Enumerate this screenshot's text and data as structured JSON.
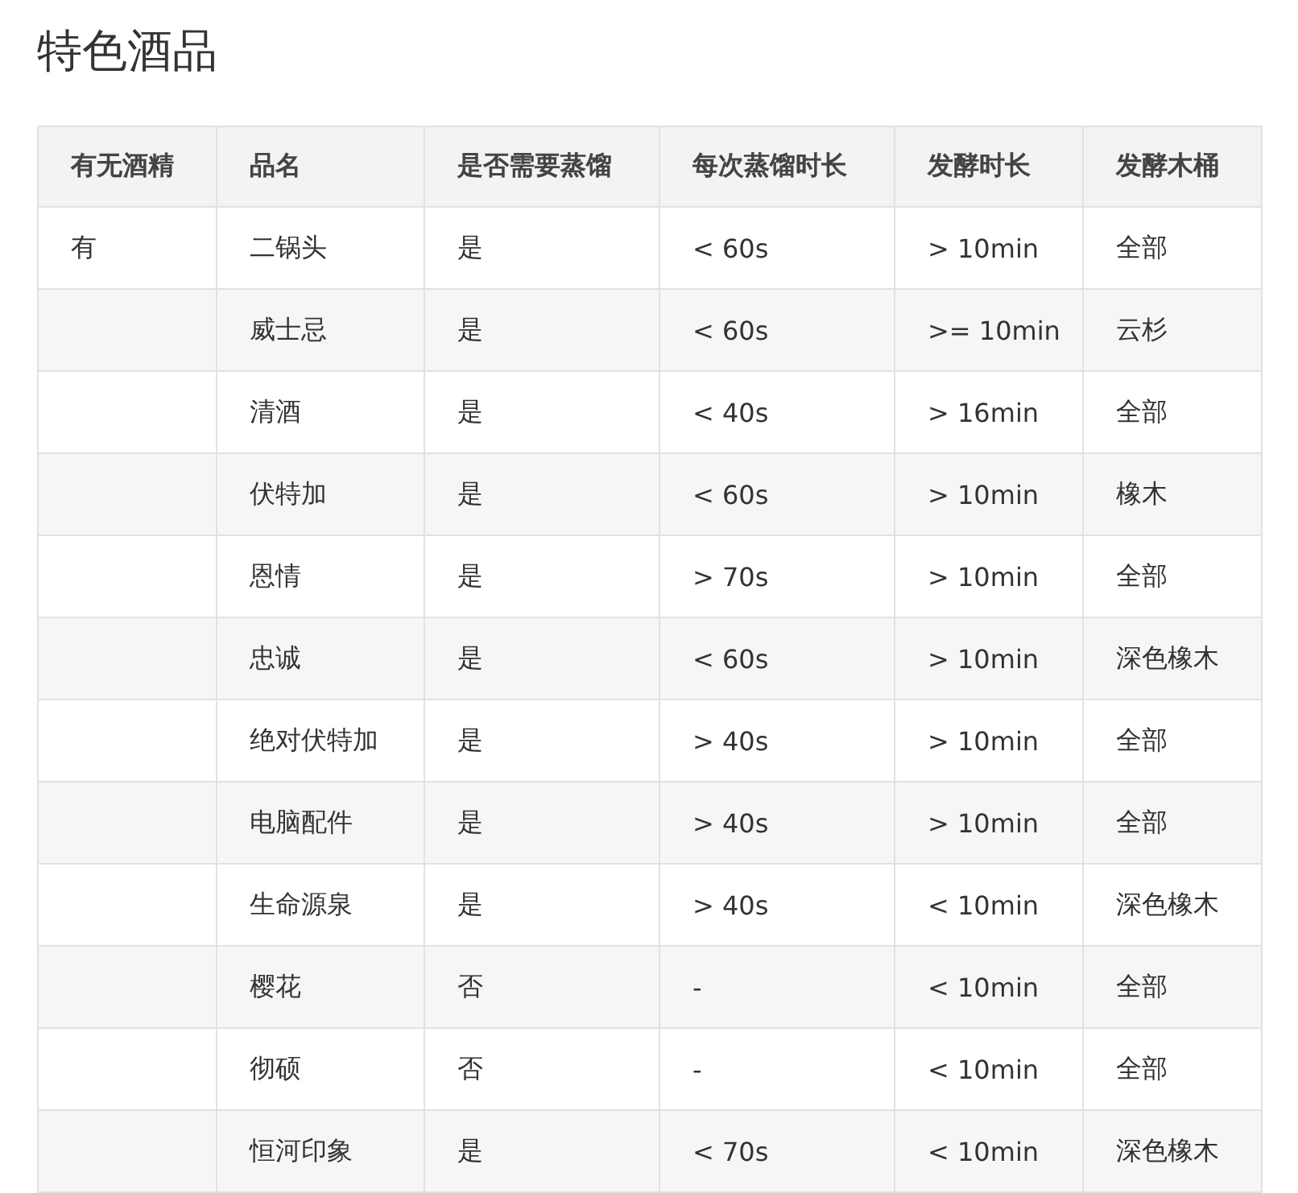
{
  "title": "特色酒品",
  "table": {
    "columns": [
      "有无酒精",
      "品名",
      "是否需要蒸馏",
      "每次蒸馏时长",
      "发酵时长",
      "发酵木桶"
    ],
    "rows": [
      {
        "has_alcohol": "有",
        "name": "二锅头",
        "distill": "是",
        "distill_time": "< 60s",
        "ferment_time": "> 10min",
        "barrel": "全部"
      },
      {
        "name": "威士忌",
        "distill": "是",
        "distill_time": "< 60s",
        "ferment_time": ">= 10min",
        "barrel": "云杉"
      },
      {
        "name": "清酒",
        "distill": "是",
        "distill_time": "< 40s",
        "ferment_time": "> 16min",
        "barrel": "全部"
      },
      {
        "name": "伏特加",
        "distill": "是",
        "distill_time": "< 60s",
        "ferment_time": "> 10min",
        "barrel": "橡木"
      },
      {
        "name": "恩情",
        "distill": "是",
        "distill_time": "> 70s",
        "ferment_time": "> 10min",
        "barrel": "全部"
      },
      {
        "name": "忠诚",
        "distill": "是",
        "distill_time": "< 60s",
        "ferment_time": "> 10min",
        "barrel": "深色橡木"
      },
      {
        "name": "绝对伏特加",
        "distill": "是",
        "distill_time": "> 40s",
        "ferment_time": "> 10min",
        "barrel": "全部"
      },
      {
        "name": "电脑配件",
        "distill": "是",
        "distill_time": "> 40s",
        "ferment_time": "> 10min",
        "barrel": "全部"
      },
      {
        "name": "生命源泉",
        "distill": "是",
        "distill_time": "> 40s",
        "ferment_time": "< 10min",
        "barrel": "深色橡木"
      },
      {
        "name": "樱花",
        "distill": "否",
        "distill_time": "-",
        "ferment_time": "< 10min",
        "barrel": "全部"
      },
      {
        "name": "彻硕",
        "distill": "否",
        "distill_time": "-",
        "ferment_time": "< 10min",
        "barrel": "全部"
      },
      {
        "name": "恒河印象",
        "distill": "是",
        "distill_time": "< 70s",
        "ferment_time": "< 10min",
        "barrel": "深色橡木"
      }
    ]
  }
}
